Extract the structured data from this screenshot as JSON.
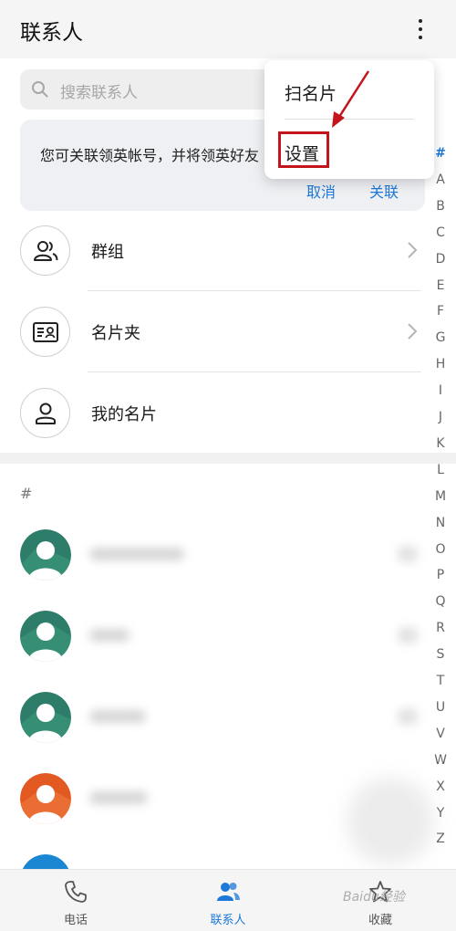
{
  "app": {
    "title": "联系人"
  },
  "search": {
    "placeholder": "搜索联系人"
  },
  "banner": {
    "text": "您可关联领英帐号，并将领英好友",
    "cancel_label": "取消",
    "link_label": "关联"
  },
  "rows": [
    {
      "label": "群组",
      "icon": "group-icon",
      "has_chevron": true
    },
    {
      "label": "名片夹",
      "icon": "card-holder-icon",
      "has_chevron": true
    },
    {
      "label": "我的名片",
      "icon": "person-icon",
      "has_chevron": false
    }
  ],
  "section_header": "#",
  "menu": {
    "items": [
      "扫名片",
      "设置"
    ],
    "highlighted_item": "设置"
  },
  "alphabet_index": [
    "#",
    "A",
    "B",
    "C",
    "D",
    "E",
    "F",
    "G",
    "H",
    "I",
    "J",
    "K",
    "L",
    "M",
    "N",
    "O",
    "P",
    "Q",
    "R",
    "S",
    "T",
    "U",
    "V",
    "W",
    "X",
    "Y",
    "Z"
  ],
  "bottom_nav": {
    "tabs": [
      {
        "label": "电话",
        "icon": "phone-icon",
        "active": false
      },
      {
        "label": "联系人",
        "icon": "contacts-icon",
        "active": true
      },
      {
        "label": "收藏",
        "icon": "star-icon",
        "active": false
      }
    ]
  },
  "watermark": "Baidu经验",
  "colors": {
    "accent": "#1e78d8",
    "highlight": "#c3161c",
    "avatar_green": "#2e7d6a",
    "avatar_orange": "#e25a22",
    "avatar_blue": "#1b86d1"
  }
}
